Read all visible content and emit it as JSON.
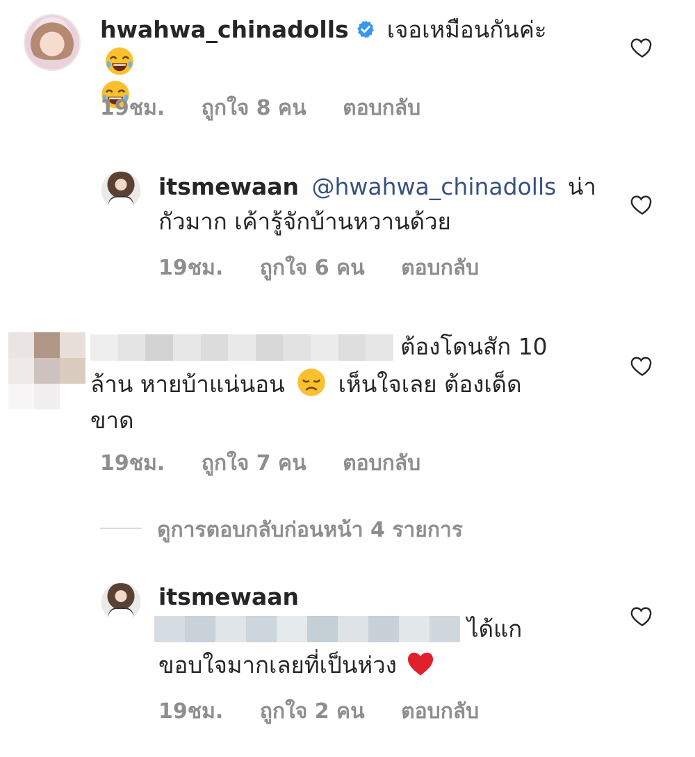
{
  "comments": [
    {
      "username": "hwahwa_chinadolls",
      "verified": true,
      "text": "เจอเหมือนกันค่ะ",
      "time": "19ชม.",
      "likes": "ถูกใจ 8 คน",
      "reply_label": "ตอบกลับ",
      "avatar_icon": "user-avatar"
    },
    {
      "username": "itsmewaan",
      "mention": "@hwahwa_chinadolls",
      "text_line1_suffix": "น่า",
      "text_line2": "กัวมาก เค้ารู้จักบ้านหวานด้วย",
      "time": "19ชม.",
      "likes": "ถูกใจ 6 คน",
      "reply_label": "ตอบกลับ",
      "avatar_icon": "user-avatar"
    },
    {
      "username_hidden": true,
      "text_line1_suffix": "ต้องโดนสัก 10",
      "text_line2_a": "ล้าน หายบ้าแน่นอน",
      "text_line2_b": "เห็นใจเลย ต้องเด็ด",
      "text_line3": "ขาด",
      "time": "19ชม.",
      "likes": "ถูกใจ 7 คน",
      "reply_label": "ตอบกลับ",
      "avatar_icon": "pixelated-avatar"
    },
    {
      "username": "itsmewaan",
      "text_line1_suffix": "ได้แก",
      "text_line2": "ขอบใจมากเลยที่เป็นห่วง",
      "time": "19ชม.",
      "likes": "ถูกใจ 2 คน",
      "reply_label": "ตอบกลับ",
      "avatar_icon": "user-avatar"
    }
  ],
  "view_previous": "ดูการตอบกลับก่อนหน้า 4 รายการ",
  "colors": {
    "text": "#262626",
    "meta": "#8e8e8e",
    "mention": "#38517f",
    "verified": "#3897f0",
    "heart_red": "#e0202b"
  },
  "icons": [
    "heart-outline-icon",
    "verified-badge-icon",
    "laughing-emoji-icon",
    "disappointed-emoji-icon",
    "red-heart-emoji-icon"
  ]
}
